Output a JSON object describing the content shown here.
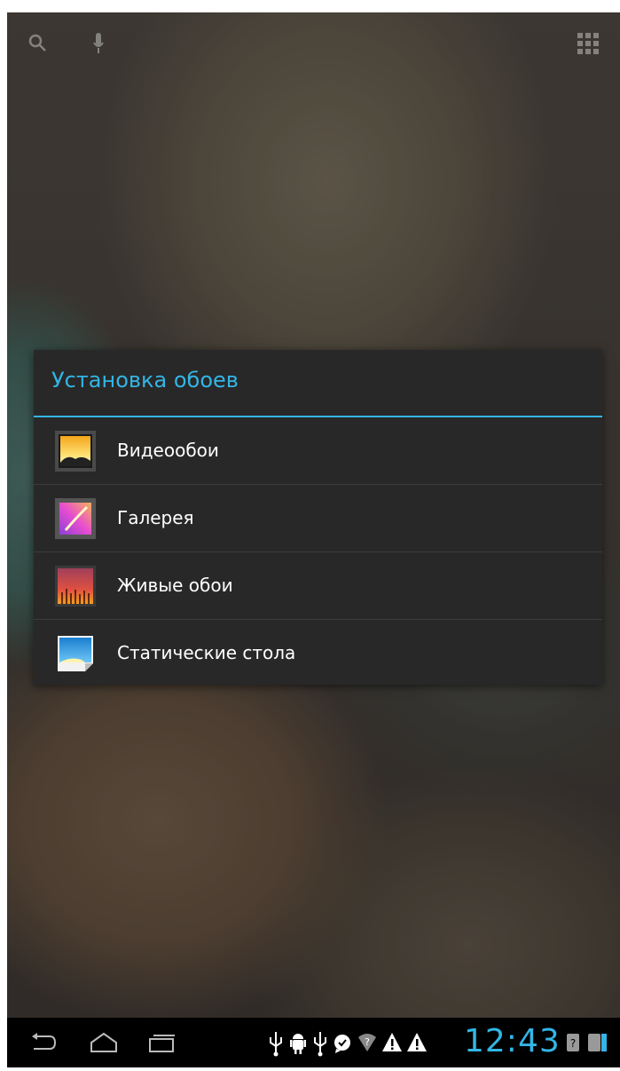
{
  "dialog": {
    "title": "Установка обоев",
    "options": [
      {
        "label": "Видеообои",
        "icon": "video-wallpaper-icon"
      },
      {
        "label": "Галерея",
        "icon": "gallery-icon"
      },
      {
        "label": "Живые обои",
        "icon": "live-wallpaper-icon"
      },
      {
        "label": "Статические стола",
        "icon": "static-wallpaper-icon"
      }
    ]
  },
  "status_bar": {
    "time": "12:43"
  },
  "colors": {
    "accent": "#33b5e5",
    "dialog_bg": "#282828",
    "nav_bg": "#000000"
  }
}
